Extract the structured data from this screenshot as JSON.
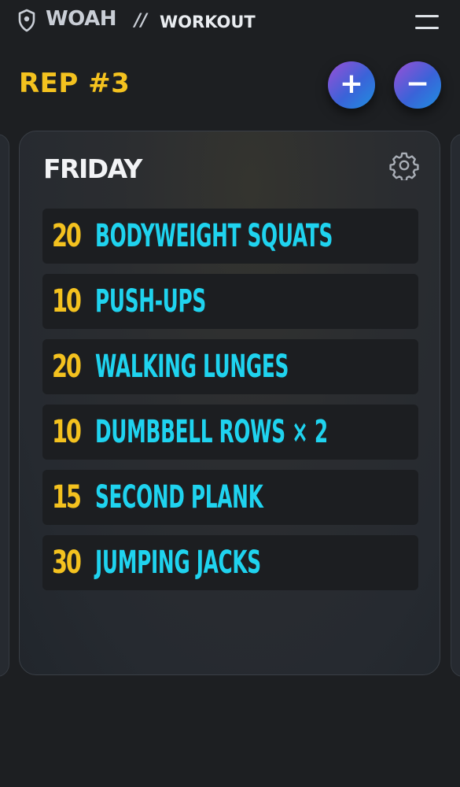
{
  "header": {
    "brand": "WOAH",
    "separator": "//",
    "section": "WORKOUT",
    "logo_icon": "shield-icon",
    "menu_icon": "hamburger-menu-icon"
  },
  "rep": {
    "title": "REP #3",
    "add_label": "+",
    "remove_label": "−",
    "add_icon": "plus-icon",
    "remove_icon": "minus-icon"
  },
  "card": {
    "day": "FRIDAY",
    "settings_icon": "gear-icon",
    "exercises": [
      {
        "count": "20",
        "name": "BODYWEIGHT SQUATS"
      },
      {
        "count": "10",
        "name": "PUSH-UPS"
      },
      {
        "count": "20",
        "name": "WALKING LUNGES"
      },
      {
        "count": "10",
        "name": "DUMBBELL ROWS × 2"
      },
      {
        "count": "15",
        "name": "SECOND PLANK"
      },
      {
        "count": "30",
        "name": "JUMPING JACKS"
      }
    ]
  },
  "colors": {
    "background": "#1d1f22",
    "accent_yellow": "#f4c21f",
    "accent_cyan": "#1fd3ef",
    "button_gradient_start": "#9b4fd6",
    "button_gradient_end": "#1f8fe0"
  }
}
